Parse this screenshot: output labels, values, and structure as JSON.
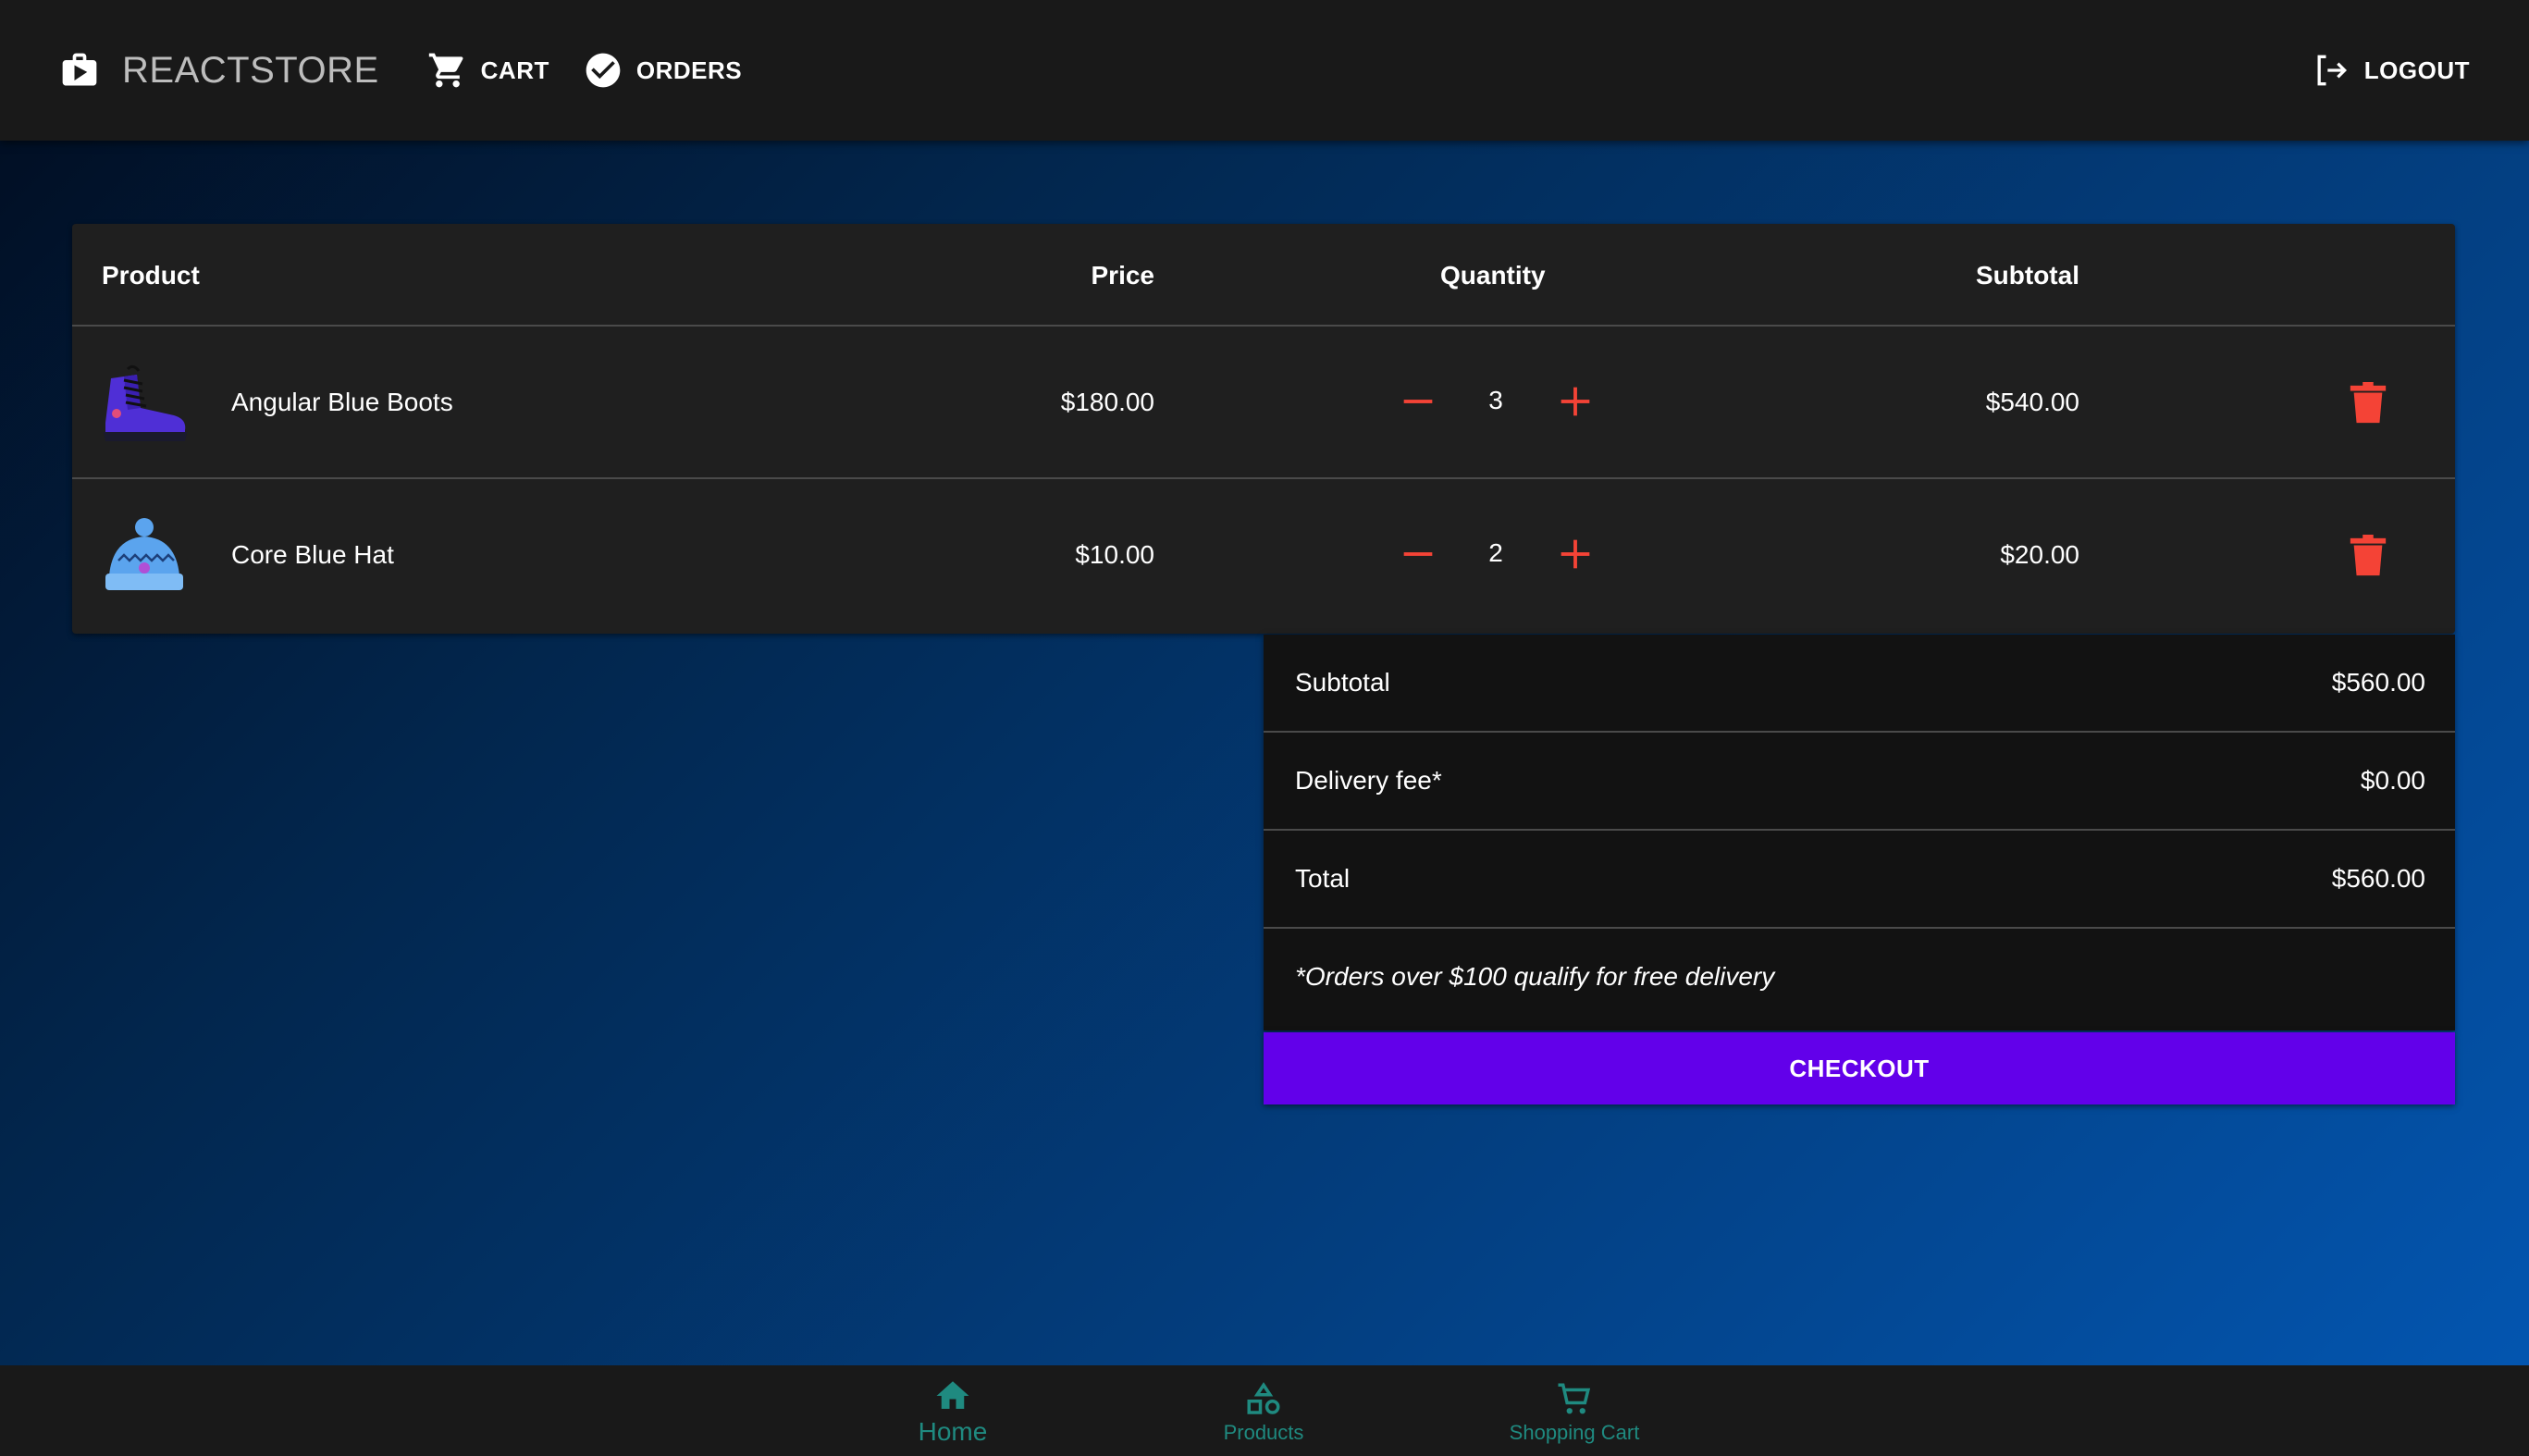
{
  "header": {
    "brand": "REACTSTORE",
    "nav": [
      {
        "label": "CART",
        "icon": "cart-icon"
      },
      {
        "label": "ORDERS",
        "icon": "check-circle-icon"
      }
    ],
    "logout": "LOGOUT"
  },
  "cart": {
    "columns": [
      "Product",
      "Price",
      "Quantity",
      "Subtotal"
    ],
    "items": [
      {
        "name": "Angular Blue Boots",
        "price": "$180.00",
        "quantity": "3",
        "subtotal": "$540.00",
        "image": "boot-image"
      },
      {
        "name": "Core Blue Hat",
        "price": "$10.00",
        "quantity": "2",
        "subtotal": "$20.00",
        "image": "hat-image"
      }
    ]
  },
  "summary": {
    "subtotal_label": "Subtotal",
    "subtotal_value": "$560.00",
    "delivery_label": "Delivery fee*",
    "delivery_value": "$0.00",
    "total_label": "Total",
    "total_value": "$560.00",
    "note": "*Orders over $100 qualify for free delivery",
    "checkout": "CHECKOUT"
  },
  "bottom_nav": [
    {
      "label": "Home",
      "icon": "home-icon"
    },
    {
      "label": "Products",
      "icon": "shapes-icon"
    },
    {
      "label": "Shopping Cart",
      "icon": "cart-icon"
    }
  ],
  "colors": {
    "appbar": "#191919",
    "accent": "#6200ea",
    "danger": "#f44336",
    "bottom_nav_active": "#1f8a80"
  }
}
